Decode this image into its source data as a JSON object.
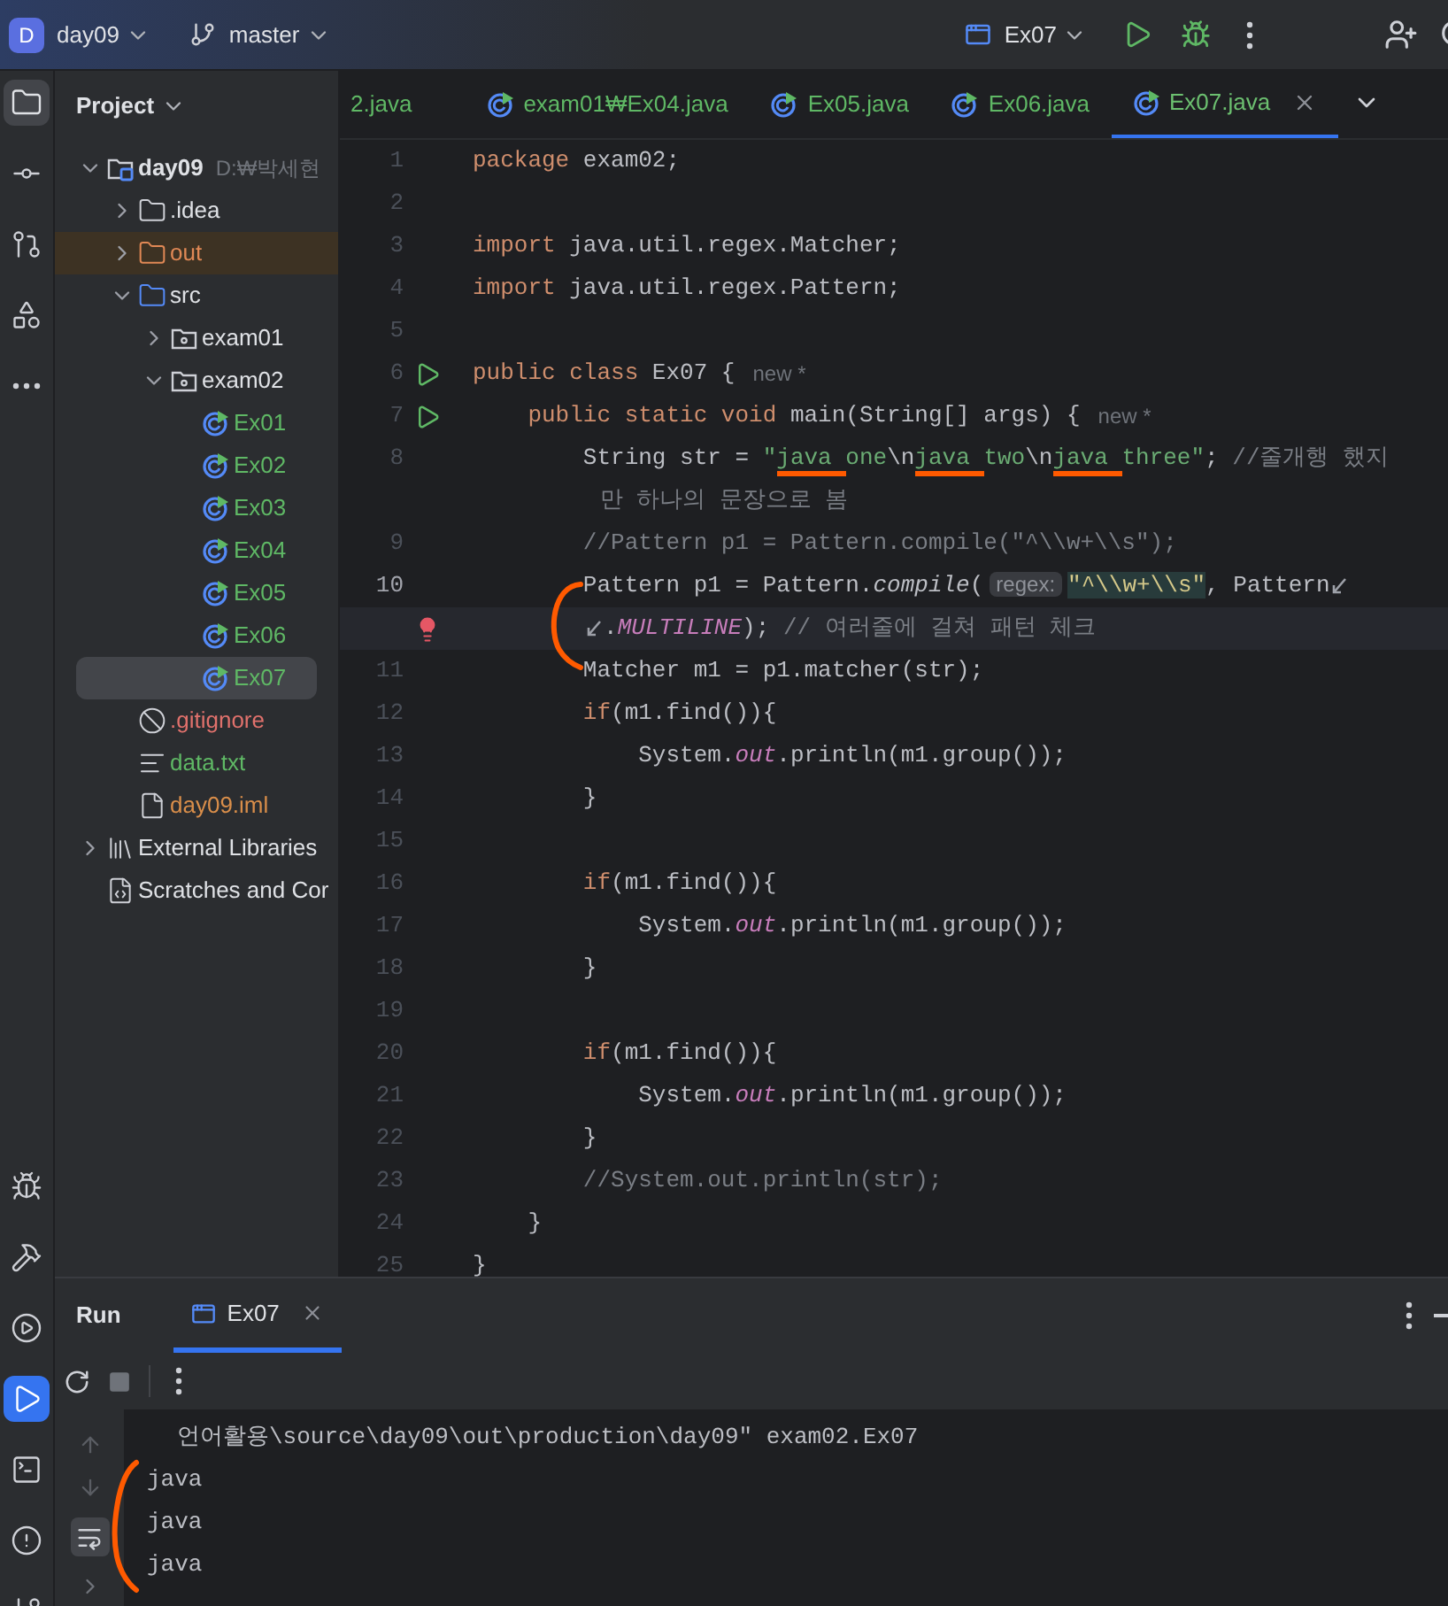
{
  "top_bar": {
    "project_initial": "D",
    "project": "day09",
    "branch": "master",
    "run_config": "Ex07"
  },
  "left_toolbar": {
    "top": [
      {
        "kind": "project",
        "selected": true
      },
      {
        "kind": "commit",
        "selected": false
      },
      {
        "kind": "pull-requests",
        "selected": false
      },
      {
        "kind": "structure",
        "selected": false
      },
      {
        "kind": "more",
        "selected": false
      }
    ],
    "bottom": [
      {
        "kind": "debug",
        "selected": false
      },
      {
        "kind": "build",
        "selected": false
      },
      {
        "kind": "services",
        "selected": false
      },
      {
        "kind": "run",
        "selected": true
      },
      {
        "kind": "terminal",
        "selected": false
      },
      {
        "kind": "problems",
        "selected": false
      },
      {
        "kind": "git",
        "selected": false
      }
    ]
  },
  "project_panel": {
    "title": "Project",
    "tree": [
      {
        "label": "day09",
        "suffix": "D:₩박세현",
        "kind": "module",
        "color": "#dfe1e5",
        "expanded": true,
        "selected": false,
        "children": [
          {
            "label": ".idea",
            "kind": "folder",
            "color": "#dfe1e5",
            "expanded": false,
            "selected": false
          },
          {
            "label": "out",
            "kind": "excluded-folder",
            "color": "#e08855",
            "expanded": false,
            "selected": false
          },
          {
            "label": "src",
            "kind": "source-folder",
            "color": "#dfe1e5",
            "expanded": true,
            "selected": false,
            "children": [
              {
                "label": "exam01",
                "kind": "package",
                "color": "#dfe1e5",
                "expanded": false,
                "selected": false
              },
              {
                "label": "exam02",
                "kind": "package",
                "color": "#dfe1e5",
                "expanded": true,
                "selected": false,
                "children": [
                  {
                    "label": "Ex01",
                    "kind": "class",
                    "color": "#5fb865",
                    "selected": false
                  },
                  {
                    "label": "Ex02",
                    "kind": "class",
                    "color": "#5fb865",
                    "selected": false
                  },
                  {
                    "label": "Ex03",
                    "kind": "class",
                    "color": "#5fb865",
                    "selected": false
                  },
                  {
                    "label": "Ex04",
                    "kind": "class",
                    "color": "#5fb865",
                    "selected": false
                  },
                  {
                    "label": "Ex05",
                    "kind": "class",
                    "color": "#5fb865",
                    "selected": false
                  },
                  {
                    "label": "Ex06",
                    "kind": "class",
                    "color": "#5fb865",
                    "selected": false
                  },
                  {
                    "label": "Ex07",
                    "kind": "class",
                    "color": "#5fb865",
                    "selected": true
                  }
                ]
              }
            ]
          },
          {
            "label": ".gitignore",
            "kind": "ignore-file",
            "color": "#e0716c",
            "selected": false
          },
          {
            "label": "data.txt",
            "kind": "text-file",
            "color": "#5fb865",
            "selected": false
          },
          {
            "label": "day09.iml",
            "kind": "iml-file",
            "color": "#d98e4a",
            "selected": false
          }
        ]
      },
      {
        "label": "External Libraries",
        "kind": "libraries",
        "color": "#dfe1e5",
        "expanded": false,
        "selected": false
      },
      {
        "label": "Scratches and Cor",
        "kind": "scratches",
        "color": "#dfe1e5",
        "selected": false
      }
    ]
  },
  "editor": {
    "tabs": [
      {
        "label": "2.java",
        "selected": false,
        "partial": true
      },
      {
        "label": "exam01₩Ex04.java",
        "selected": false,
        "partial": false
      },
      {
        "label": "Ex05.java",
        "selected": false,
        "partial": false
      },
      {
        "label": "Ex06.java",
        "selected": false,
        "partial": false
      },
      {
        "label": "Ex07.java",
        "selected": true,
        "partial": false
      }
    ],
    "lines": [
      {
        "number": "1",
        "current": false,
        "segments": [
          {
            "kind": "kw",
            "text": "package"
          },
          {
            "kind": "plain",
            "text": " exam02;"
          }
        ]
      },
      {
        "number": "2",
        "current": false
      },
      {
        "number": "3",
        "current": false,
        "segments": [
          {
            "kind": "kw",
            "text": "import"
          },
          {
            "kind": "plain",
            "text": " java.util.regex.Matcher;"
          }
        ]
      },
      {
        "number": "4",
        "current": false,
        "segments": [
          {
            "kind": "kw",
            "text": "import"
          },
          {
            "kind": "plain",
            "text": " java.util.regex.Pattern;"
          }
        ]
      },
      {
        "number": "5",
        "current": false
      },
      {
        "number": "6",
        "current": false,
        "runnable": true,
        "hint": "new *",
        "segments": [
          {
            "kind": "kw",
            "text": "public class"
          },
          {
            "kind": "plain",
            "text": " Ex07 {"
          }
        ]
      },
      {
        "number": "7",
        "current": false,
        "runnable": true,
        "hint": "new *",
        "segments": [
          {
            "kind": "kw",
            "text": "    public static void"
          },
          {
            "kind": "plain",
            "text": " main(String[] args) {"
          }
        ]
      },
      {
        "number": "8",
        "current": false,
        "segments": [
          {
            "kind": "plain",
            "text": "        String str = "
          },
          {
            "kind": "str",
            "text": "\""
          },
          {
            "kind": "str-marked",
            "text": "java "
          },
          {
            "kind": "str",
            "text": "one"
          },
          {
            "kind": "plain",
            "text": "\\n"
          },
          {
            "kind": "str-marked",
            "text": "java "
          },
          {
            "kind": "str",
            "text": "two"
          },
          {
            "kind": "plain",
            "text": "\\n"
          },
          {
            "kind": "str-marked",
            "text": "java "
          },
          {
            "kind": "str",
            "text": "three\""
          },
          {
            "kind": "plain",
            "text": "; "
          },
          {
            "kind": "cmt",
            "text": "//줄개행 했지"
          }
        ],
        "wrap": {
          "wrap_marks": false,
          "error": false,
          "segments": [
            {
              "kind": "cmt",
              "text": " 만 하나의 문장으로 봄"
            }
          ]
        }
      },
      {
        "number": "9",
        "current": false,
        "segments": [
          {
            "kind": "cmt",
            "text": "        //Pattern p1 = Pattern.compile(\"^\\\\w+\\\\s\");"
          }
        ]
      },
      {
        "number": "10",
        "current": true,
        "segments": [
          {
            "kind": "plain",
            "text": "        Pattern p1 = Pattern."
          },
          {
            "kind": "method",
            "text": "compile"
          },
          {
            "kind": "plain",
            "text": "("
          },
          {
            "kind": "inlay",
            "text": "regex:"
          },
          {
            "kind": "regex",
            "text": "\"^\\\\w+\\\\s\""
          },
          {
            "kind": "plain",
            "text": ", Pattern"
          }
        ],
        "wrap": {
          "wrap_marks": true,
          "error": true,
          "segments": [
            {
              "kind": "plain",
              "text": "."
            },
            {
              "kind": "static",
              "text": "MULTILINE"
            },
            {
              "kind": "plain",
              "text": "); "
            },
            {
              "kind": "cmt",
              "text": "// 여러줄에 걸쳐 패턴 체크"
            }
          ]
        }
      },
      {
        "number": "11",
        "current": false,
        "segments": [
          {
            "kind": "plain",
            "text": "        Matcher m1 = p1.matcher(str);"
          }
        ]
      },
      {
        "number": "12",
        "current": false,
        "segments": [
          {
            "kind": "kw",
            "text": "        if"
          },
          {
            "kind": "plain",
            "text": "(m1.find()){"
          }
        ]
      },
      {
        "number": "13",
        "current": false,
        "segments": [
          {
            "kind": "plain",
            "text": "            System."
          },
          {
            "kind": "static",
            "text": "out"
          },
          {
            "kind": "plain",
            "text": ".println(m1.group());"
          }
        ]
      },
      {
        "number": "14",
        "current": false,
        "segments": [
          {
            "kind": "plain",
            "text": "        }"
          }
        ]
      },
      {
        "number": "15",
        "current": false
      },
      {
        "number": "16",
        "current": false,
        "segments": [
          {
            "kind": "kw",
            "text": "        if"
          },
          {
            "kind": "plain",
            "text": "(m1.find()){"
          }
        ]
      },
      {
        "number": "17",
        "current": false,
        "segments": [
          {
            "kind": "plain",
            "text": "            System."
          },
          {
            "kind": "static",
            "text": "out"
          },
          {
            "kind": "plain",
            "text": ".println(m1.group());"
          }
        ]
      },
      {
        "number": "18",
        "current": false,
        "segments": [
          {
            "kind": "plain",
            "text": "        }"
          }
        ]
      },
      {
        "number": "19",
        "current": false
      },
      {
        "number": "20",
        "current": false,
        "segments": [
          {
            "kind": "kw",
            "text": "        if"
          },
          {
            "kind": "plain",
            "text": "(m1.find()){"
          }
        ]
      },
      {
        "number": "21",
        "current": false,
        "segments": [
          {
            "kind": "plain",
            "text": "            System."
          },
          {
            "kind": "static",
            "text": "out"
          },
          {
            "kind": "plain",
            "text": ".println(m1.group());"
          }
        ]
      },
      {
        "number": "22",
        "current": false,
        "segments": [
          {
            "kind": "plain",
            "text": "        }"
          }
        ]
      },
      {
        "number": "23",
        "current": false,
        "segments": [
          {
            "kind": "cmt",
            "text": "        //System.out.println(str);"
          }
        ]
      },
      {
        "number": "24",
        "current": false,
        "segments": [
          {
            "kind": "plain",
            "text": "    }"
          }
        ]
      },
      {
        "number": "25",
        "current": false,
        "segments": [
          {
            "kind": "plain",
            "text": "}"
          }
        ]
      }
    ]
  },
  "run_panel": {
    "title": "Run",
    "tabs": [
      {
        "label": "Ex07",
        "selected": true
      }
    ],
    "output": [
      {
        "kind": "wrapped",
        "text": "언어활용\\source\\day09\\out\\production\\day09\" exam02.Ex07"
      },
      {
        "kind": "stdout",
        "text": "java"
      },
      {
        "kind": "stdout",
        "text": "java"
      },
      {
        "kind": "stdout",
        "text": "java"
      }
    ]
  }
}
